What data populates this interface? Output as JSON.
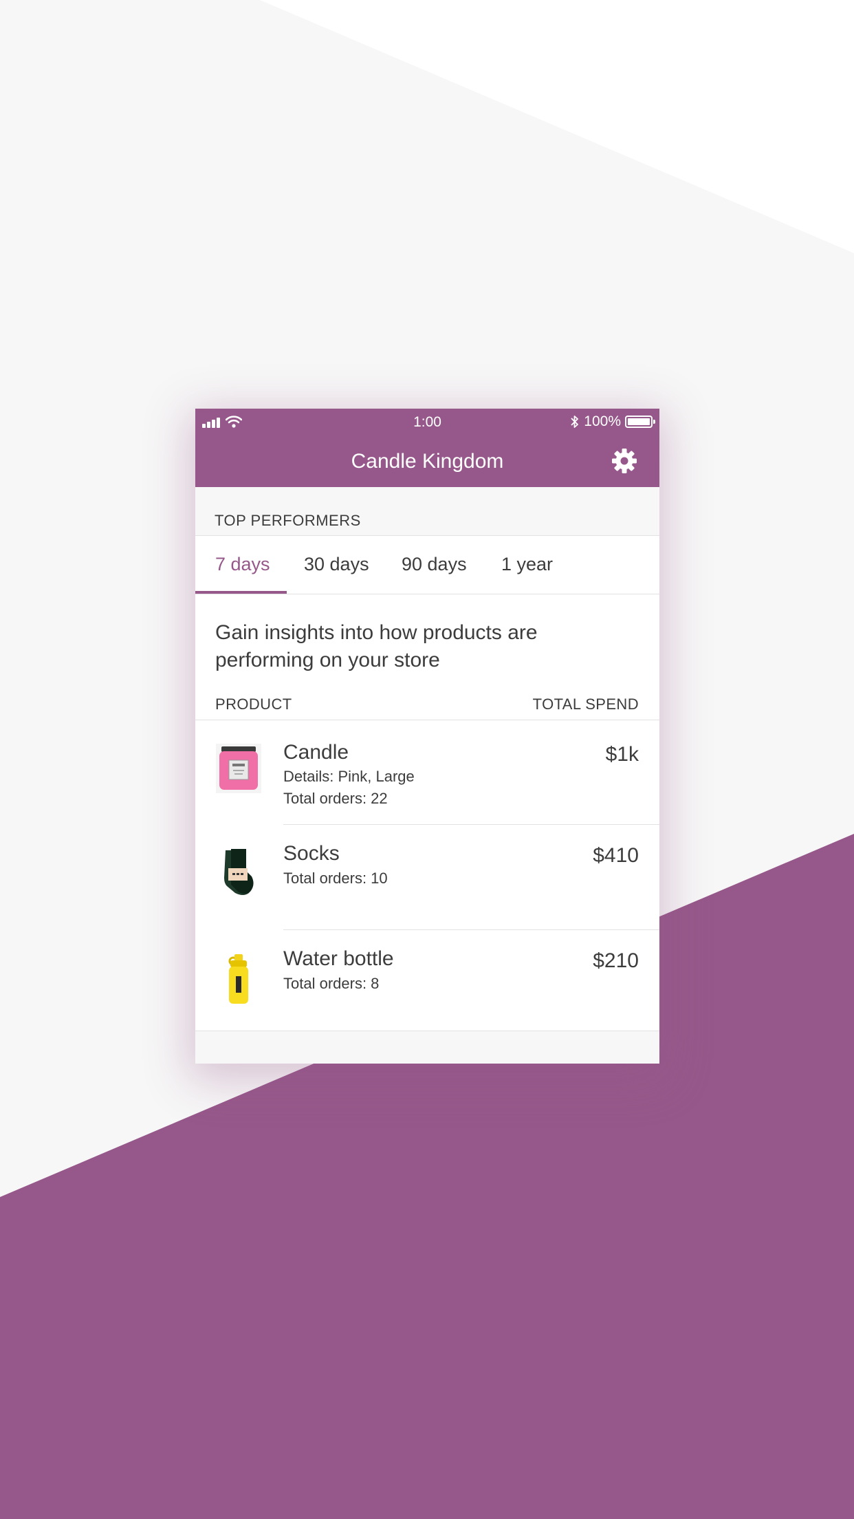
{
  "status_bar": {
    "time": "1:00",
    "battery": "100%"
  },
  "header": {
    "title": "Candle Kingdom",
    "settings_icon": "gear-icon"
  },
  "section": {
    "title": "TOP PERFORMERS"
  },
  "tabs": [
    {
      "label": "7 days",
      "active": true
    },
    {
      "label": "30 days",
      "active": false
    },
    {
      "label": "90 days",
      "active": false
    },
    {
      "label": "1 year",
      "active": false
    }
  ],
  "insight_text": "Gain insights into how products are performing on your store",
  "table": {
    "product_header": "PRODUCT",
    "spend_header": "TOTAL SPEND",
    "rows": [
      {
        "name": "Candle",
        "details": "Details: Pink, Large",
        "orders": "Total orders: 22",
        "spend": "$1k",
        "thumb": "candle-jar-image"
      },
      {
        "name": "Socks",
        "details": "",
        "orders": "Total orders: 10",
        "spend": "$410",
        "thumb": "socks-image"
      },
      {
        "name": "Water bottle",
        "details": "",
        "orders": "Total orders: 8",
        "spend": "$210",
        "thumb": "water-bottle-image"
      }
    ]
  },
  "colors": {
    "brand": "#96588a",
    "background": "#f7f7f7",
    "text": "#3c3c3c",
    "divider": "#e2e2e2"
  }
}
